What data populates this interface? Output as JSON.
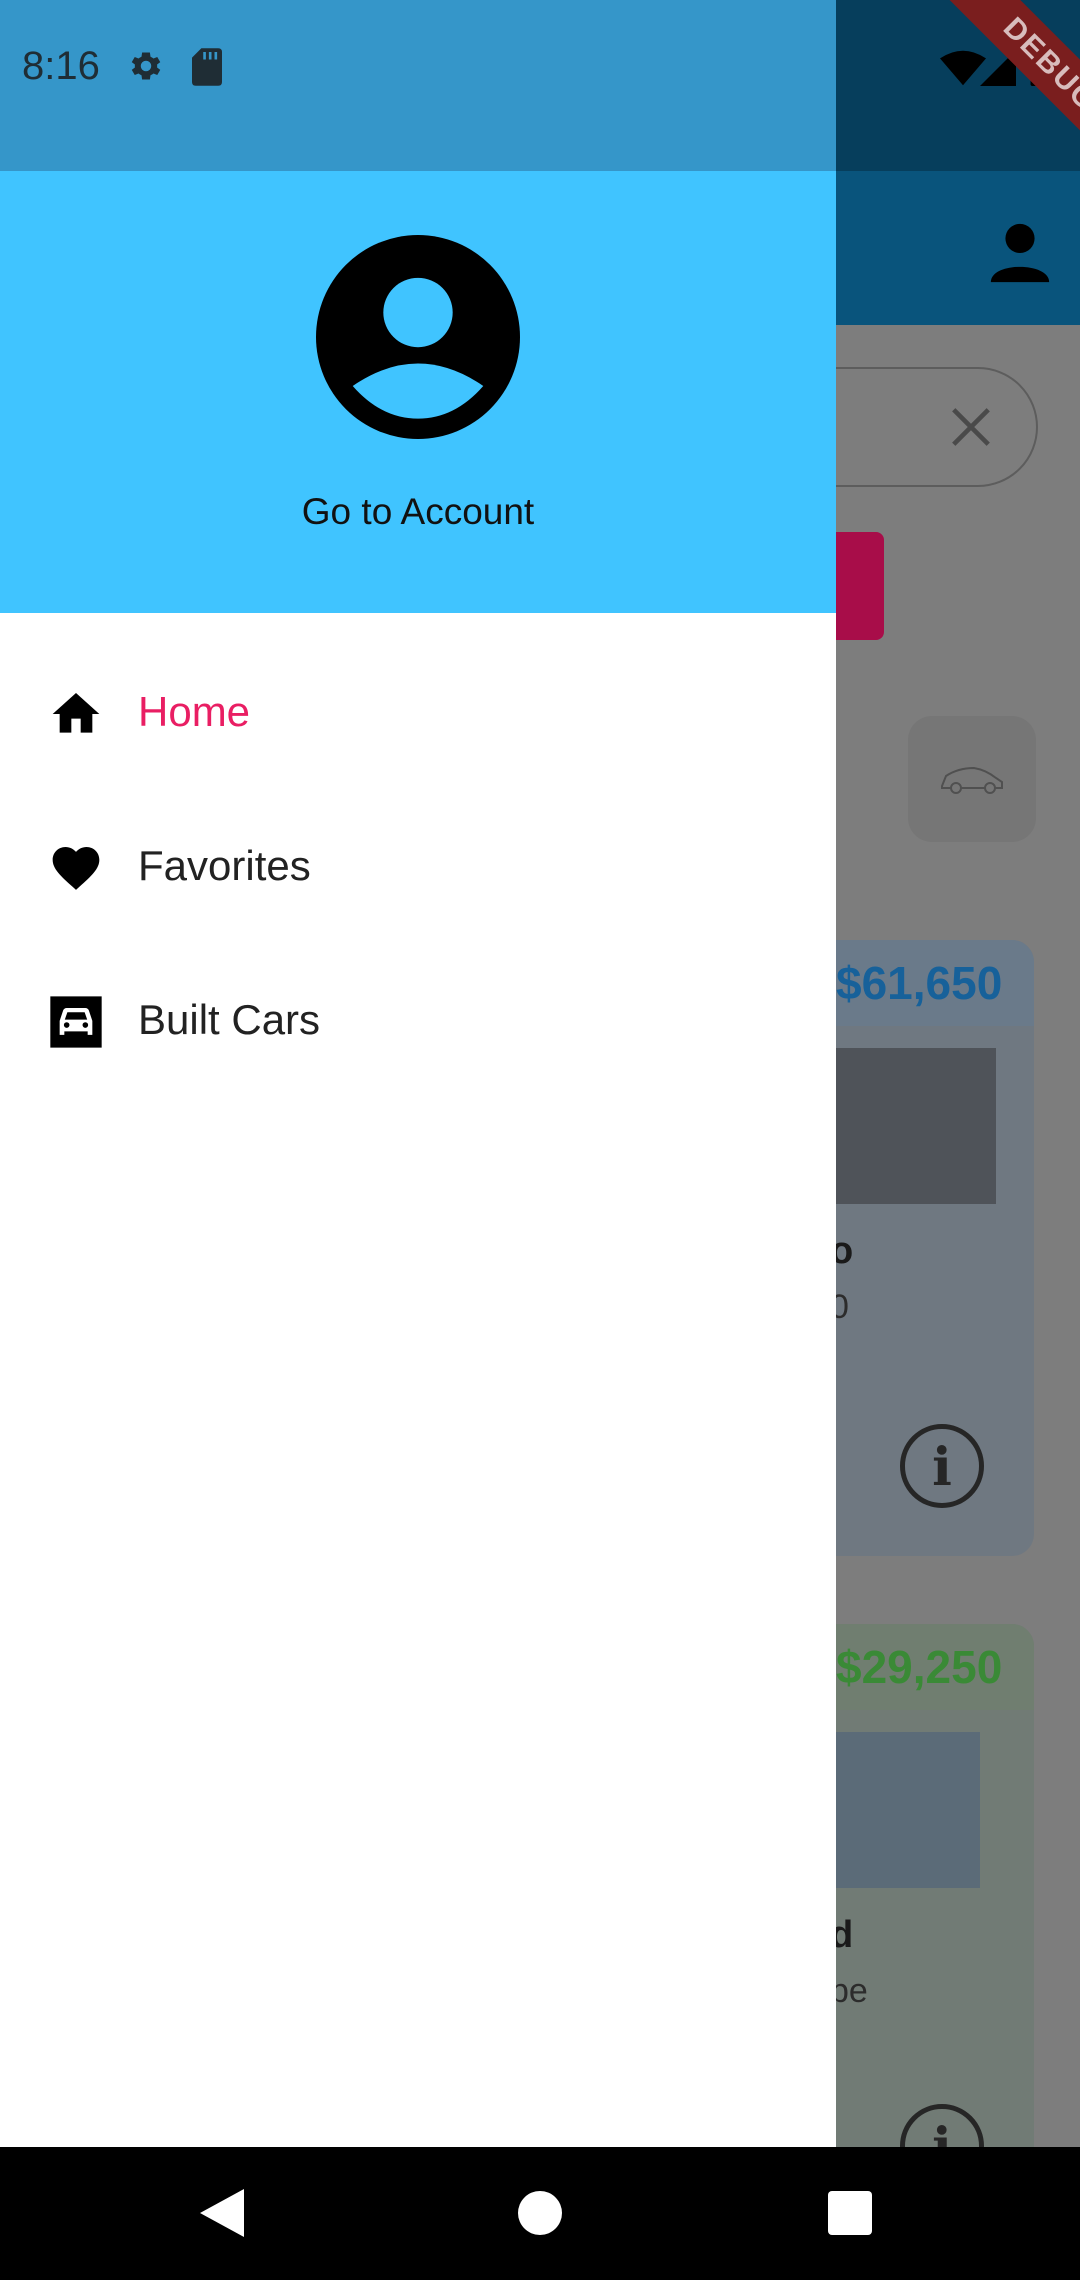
{
  "status_bar": {
    "time": "8:16",
    "icons": [
      "gear-icon",
      "sd-card-icon",
      "wifi-icon",
      "signal-icon",
      "battery-icon"
    ]
  },
  "debug_banner": "DEBUG",
  "drawer": {
    "header": {
      "avatar_icon": "account-circle-icon",
      "label": "Go to Account",
      "background": "#40c4ff"
    },
    "items": [
      {
        "icon": "home-icon",
        "label": "Home",
        "active": true
      },
      {
        "icon": "heart-icon",
        "label": "Favorites",
        "active": false
      },
      {
        "icon": "car-icon",
        "label": "Built Cars",
        "active": false
      }
    ],
    "active_color": "#e91e63"
  },
  "background_content": {
    "cards": [
      {
        "price": "$61,650",
        "name_fragment": "o",
        "sub_fragment": "0"
      },
      {
        "price": "$29,250",
        "name_fragment": "d",
        "sub_fragment": "pe"
      }
    ]
  },
  "nav_bar": {
    "buttons": [
      "back-icon",
      "home-circle-icon",
      "recents-icon"
    ]
  }
}
